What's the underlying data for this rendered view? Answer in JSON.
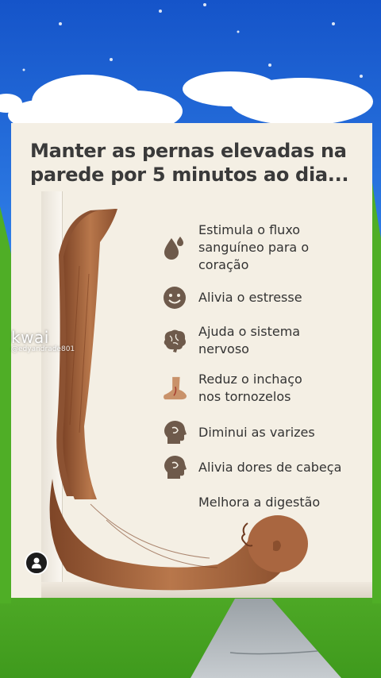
{
  "card": {
    "title": "Manter as pernas elevadas na parede por 5 minutos ao dia...",
    "benefits": [
      {
        "icon": "water-drop-icon",
        "text": "Estimula o fluxo\nsanguíneo para o\ncoração"
      },
      {
        "icon": "smile-face-icon",
        "text": "Alivia o estresse"
      },
      {
        "icon": "brain-icon",
        "text": "Ajuda o sistema\nnervoso"
      },
      {
        "icon": "foot-icon",
        "text": "Reduz o inchaço\nnos tornozelos"
      },
      {
        "icon": "head-profile-icon",
        "text": "Diminui as varizes"
      },
      {
        "icon": "head-profile-icon",
        "text": "Alivia dores de cabeça"
      },
      {
        "icon": "",
        "text": "Melhora a digestão"
      }
    ]
  },
  "watermark": {
    "logo": "kwai",
    "handle": "@edyandrade801"
  },
  "colors": {
    "sky": "#1f63d6",
    "grass": "#5fbf2e",
    "card": "#f4efe4",
    "skin": "#a8673f",
    "icon": "#6e5a4b"
  }
}
